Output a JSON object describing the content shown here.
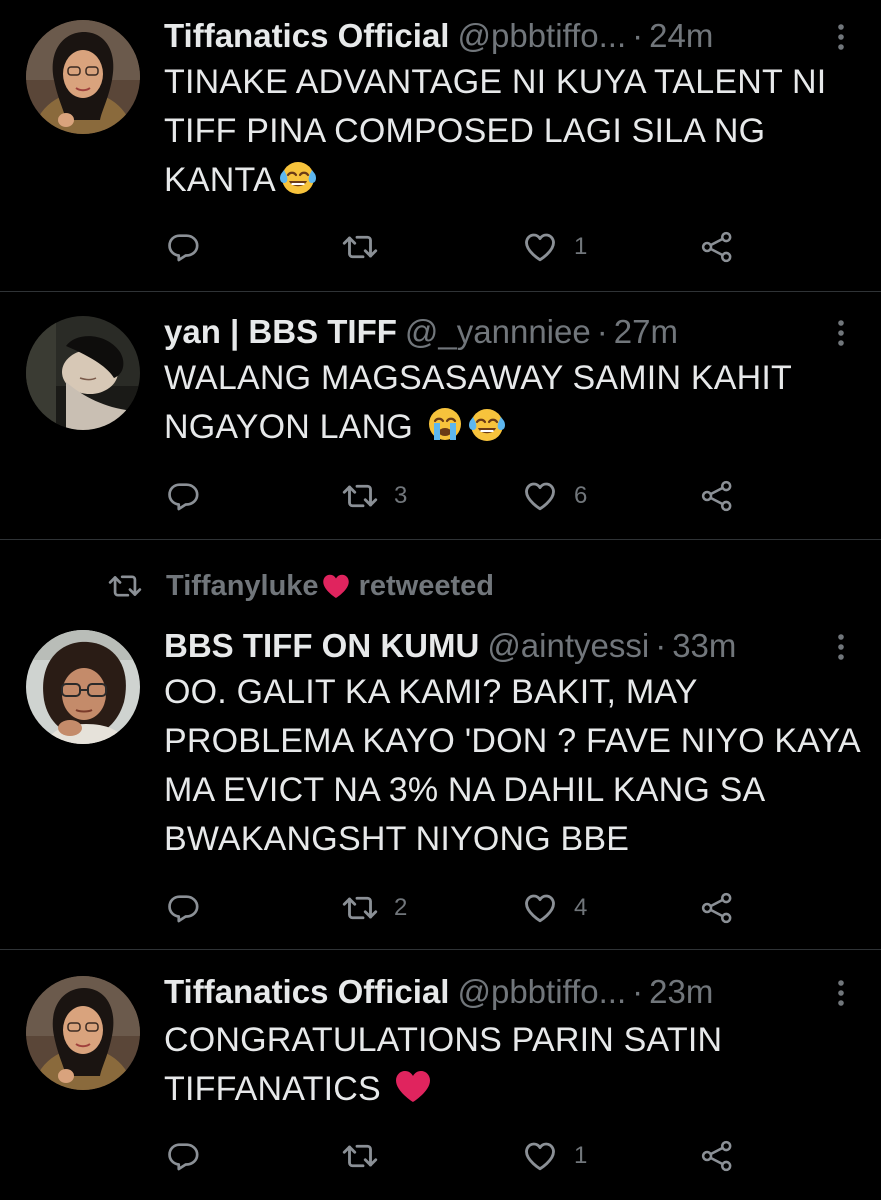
{
  "colors": {
    "background": "#000000",
    "text": "#e7e9ea",
    "secondary": "#71767b",
    "divider": "#2f3336",
    "heart_red": "#e0245e"
  },
  "retweet_context": {
    "user": "Tiffanyluke",
    "verb": "retweeted",
    "icon": "retweet-icon"
  },
  "tweets": [
    {
      "name": "Tiffanatics Official",
      "handle": "@pbbtiffo...",
      "separator": "·",
      "time": "24m",
      "text": "TINAKE ADVANTAGE NI KUYA TALENT NI TIFF PINA COMPOSED LAGI SILA NG KANTA",
      "emojis": [
        "face-with-tears-of-joy"
      ],
      "retweets": "",
      "likes": "1"
    },
    {
      "name": "yan | BBS TIFF",
      "handle": "@_yannniee",
      "separator": "·",
      "time": "27m",
      "text": "WALANG MAGSASAWAY SAMIN KAHIT NGAYON LANG ",
      "emojis": [
        "loudly-crying-face",
        "face-with-tears-of-joy"
      ],
      "retweets": "3",
      "likes": "6"
    },
    {
      "name": "BBS TIFF ON KUMU",
      "handle": "@aintyessi",
      "separator": "·",
      "time": "33m",
      "text": "OO. GALIT KA KAMI? BAKIT, MAY PROBLEMA KAYO 'DON ? FAVE NIYO KAYA MA EVICT NA 3% NA DAHIL KANG SA BWAKANGSHT NIYONG BBE",
      "emojis": [],
      "retweets": "2",
      "likes": "4"
    },
    {
      "name": "Tiffanatics Official",
      "handle": "@pbbtiffo...",
      "separator": "·",
      "time": "23m",
      "text": "CONGRATULATIONS PARIN SATIN TIFFANATICS ",
      "emojis": [
        "red-heart"
      ],
      "retweets": "",
      "likes": "1"
    }
  ]
}
